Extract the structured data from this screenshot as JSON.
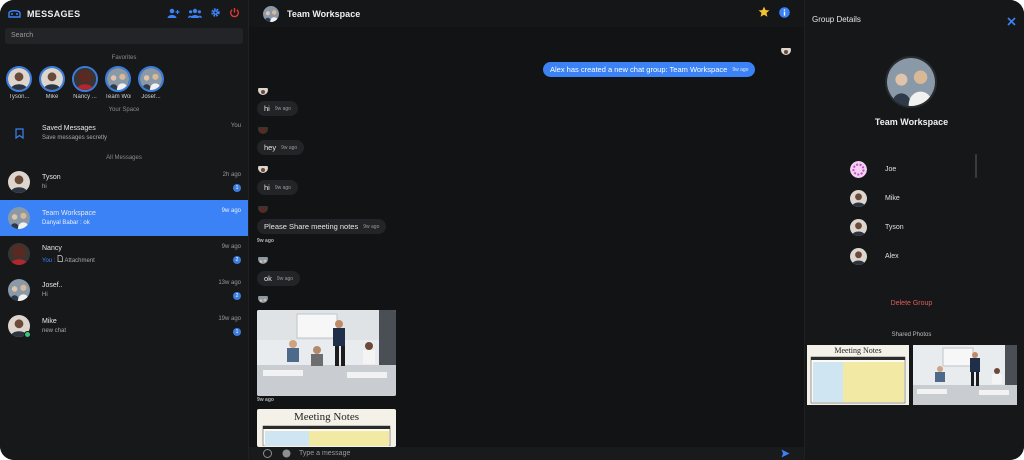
{
  "app": {
    "title": "MESSAGES",
    "search_placeholder": "Search",
    "sections": {
      "favorites": "Favorites",
      "your_space": "Your Space",
      "all_messages": "All Messages"
    }
  },
  "favorites": [
    {
      "name": "Tyson..."
    },
    {
      "name": "Mike"
    },
    {
      "name": "Nancy ..."
    },
    {
      "name": "Team Wor..."
    },
    {
      "name": "Josef..."
    }
  ],
  "saved": {
    "title": "Saved Messages",
    "subtitle": "Save messages secretly",
    "tag": "You"
  },
  "conversations": [
    {
      "name": "Tyson",
      "preview": "hi",
      "time": "2h ago",
      "badge": "1"
    },
    {
      "name": "Team Workspace",
      "preview": "Danyal Babar : ok",
      "time": "9w ago",
      "badge": ""
    },
    {
      "name": "Nancy",
      "preview_you": "You :",
      "preview": "Attachment",
      "time": "9w ago",
      "badge": "2"
    },
    {
      "name": "Josef..",
      "preview": "Hi",
      "time": "13w ago",
      "badge": "2"
    },
    {
      "name": "Mike",
      "preview": "new chat",
      "time": "19w ago",
      "badge": "1"
    }
  ],
  "chat": {
    "title": "Team Workspace",
    "system_message": "Alex has created a new chat group: Team Workspace",
    "system_time": "9w ago",
    "messages": [
      {
        "text": "hi",
        "time": "9w ago"
      },
      {
        "text": "hey",
        "time": "9w ago"
      },
      {
        "text": "hi",
        "time": "9w ago"
      },
      {
        "text": "Please Share meeting notes",
        "time": "9w ago"
      },
      {
        "text": "ok",
        "time": "9w ago"
      }
    ],
    "stamps": [
      "9w ago",
      "9w ago"
    ],
    "notes_heading": "Meeting Notes",
    "composer_placeholder": "Type a message"
  },
  "details": {
    "title": "Group Details",
    "group_name": "Team Workspace",
    "members": [
      {
        "name": "Joe"
      },
      {
        "name": "Mike"
      },
      {
        "name": "Tyson"
      },
      {
        "name": "Alex"
      }
    ],
    "delete_label": "Delete Group",
    "shared_label": "Shared Photos",
    "notes_heading": "Meeting Notes"
  },
  "colors": {
    "accent": "#3b82f6",
    "danger": "#e05b5b",
    "star": "#f4c430",
    "power": "#e53935"
  }
}
